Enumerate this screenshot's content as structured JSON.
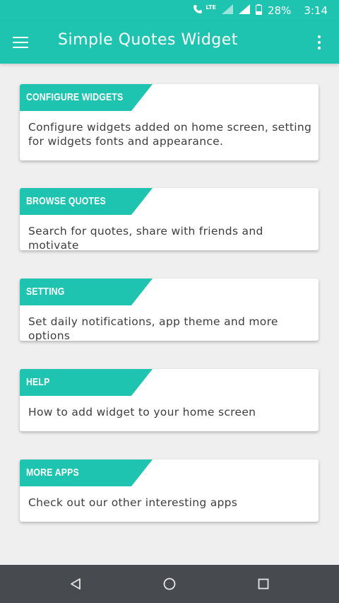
{
  "status_bar": {
    "network_label": "LTE",
    "battery": "28%",
    "time": "3:14"
  },
  "app_bar": {
    "title": "Simple Quotes Widget"
  },
  "cards": [
    {
      "title": "CONFIGURE WIDGETS",
      "description": "Configure widgets added on home screen, setting for widgets fonts and appearance."
    },
    {
      "title": "BROWSE QUOTES",
      "description": "Search for quotes, share with friends and motivate"
    },
    {
      "title": "SETTING",
      "description": "Set daily notifications, app theme and more options"
    },
    {
      "title": "HELP",
      "description": "How to add widget to your home screen"
    },
    {
      "title": "MORE APPS",
      "description": "Check out our other interesting apps"
    }
  ],
  "colors": {
    "accent": "#1ec4b0",
    "background": "#efefef",
    "nav_bar": "#474b50"
  },
  "icons": {
    "menu": "hamburger-menu-icon",
    "overflow": "more-vertical-icon",
    "back": "back-triangle-icon",
    "home": "home-circle-icon",
    "recents": "recents-square-icon"
  }
}
